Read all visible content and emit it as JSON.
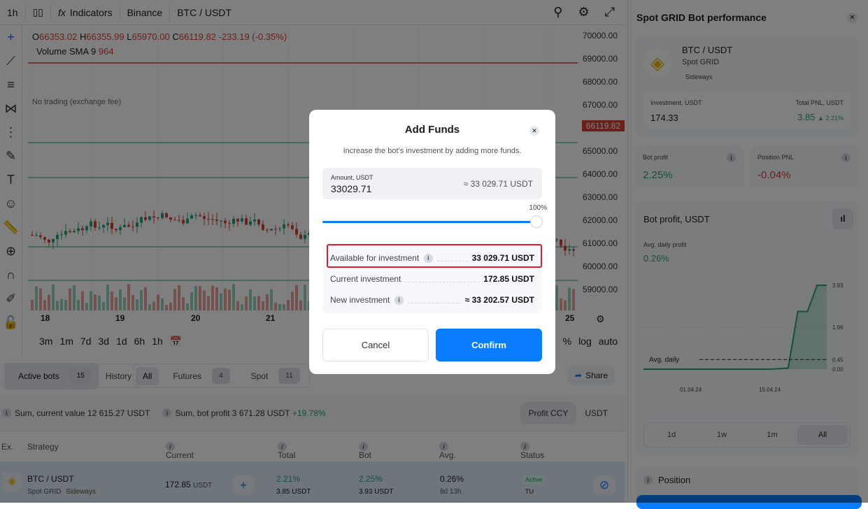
{
  "topbar": {
    "interval": "1h",
    "indicators": "Indicators",
    "exchange": "Binance",
    "symbol": "BTC / USDT"
  },
  "legend": {
    "o_label": "O",
    "o": "66353.02",
    "h_label": "H",
    "h": "66355.99",
    "l_label": "L",
    "l": "65970.00",
    "c_label": "C",
    "c": "66119.82",
    "change": "-233.19 (-0.35%)",
    "volume_label": "Volume SMA 9",
    "volume": "964",
    "no_trading": "No trading (exchange fee)"
  },
  "price_axis": [
    "70000.00",
    "69000.00",
    "68000.00",
    "67000.00",
    "66119.82",
    "65000.00",
    "64000.00",
    "63000.00",
    "62000.00",
    "61000.00",
    "60000.00",
    "59000.00"
  ],
  "x_axis": [
    "18",
    "19",
    "20",
    "21",
    "25"
  ],
  "timeframes": [
    "3m",
    "1m",
    "7d",
    "3d",
    "1d",
    "6h",
    "1h"
  ],
  "scale_opts": [
    "%",
    "log",
    "auto"
  ],
  "bots_tabs": {
    "active": "Active bots",
    "active_count": "15",
    "history": "History",
    "all": "All",
    "futures": "Futures",
    "futures_count": "4",
    "spot": "Spot",
    "spot_count": "11",
    "share": "Share"
  },
  "summary": {
    "current_value": "Sum, current value 12 615.27 USDT",
    "bot_profit": "Sum, bot profit 3 671.28 USDT",
    "bot_profit_pct": "+19.78%",
    "profit_ccy": "Profit CCY",
    "usdt": "USDT"
  },
  "table": {
    "headers": [
      "Ex.",
      "Strategy",
      "Current value",
      "Total PNL",
      "Bot profit",
      "Avg. daily",
      "Status"
    ],
    "row": {
      "pair": "BTC / USDT",
      "type": "Spot GRID",
      "tag": "Sideways",
      "value": "172.85",
      "value_unit": "USDT",
      "pnl_pct": "2.21%",
      "pnl": "3.85 USDT",
      "profit_pct": "2.25%",
      "profit": "3.93 USDT",
      "avg": "0.26%",
      "age": "8d 13h",
      "status": "Active",
      "status2": "TU"
    }
  },
  "panel": {
    "title": "Spot GRID Bot performance",
    "pair": "BTC / USDT",
    "type": "Spot GRID",
    "tag": "Sideways",
    "investment_label": "Investment, USDT",
    "investment": "174.33",
    "pnl_label": "Total PNL, USDT",
    "pnl": "3.85",
    "pnl_pct": "2.21%",
    "bot_profit_label": "Bot profit",
    "bot_profit": "2.25%",
    "position_pnl_label": "Position PNL",
    "position_pnl": "-0.04%",
    "chart_title": "Bot profit, USDT",
    "avg_daily_label": "Avg. daily profit",
    "avg_daily": "0.26%",
    "avg_line_label": "Avg. daily",
    "y_ticks": [
      "3.93",
      "1.96",
      "0.45",
      "0.00"
    ],
    "x_ticks": [
      "01.04.24",
      "15.04.24"
    ],
    "ranges": [
      "1d",
      "1w",
      "1m",
      "All"
    ],
    "position": "Position",
    "profit_series": [
      0,
      0,
      0,
      0,
      0,
      0,
      0,
      0,
      0,
      0,
      0,
      0,
      0,
      0,
      0.02,
      0.05,
      2.7,
      2.7,
      3.93,
      3.93
    ],
    "colors": {
      "line": "#26a17b",
      "positive": "#26a17b",
      "negative": "#d1423b"
    }
  },
  "modal": {
    "title": "Add Funds",
    "subtitle": "Increase the bot’s investment by adding more funds.",
    "amount_label": "Amount, USDT",
    "amount": "33029.71",
    "amount_approx": "≈ 33 029.71 USDT",
    "percent": "100%",
    "percent_value": 100,
    "available_label": "Available for investment",
    "available": "33 029.71 USDT",
    "current_label": "Current investment",
    "current": "172.85 USDT",
    "new_label": "New investment",
    "new": "≈ 33 202.57 USDT",
    "cancel": "Cancel",
    "confirm": "Confirm",
    "accent": "#0a7cff"
  }
}
